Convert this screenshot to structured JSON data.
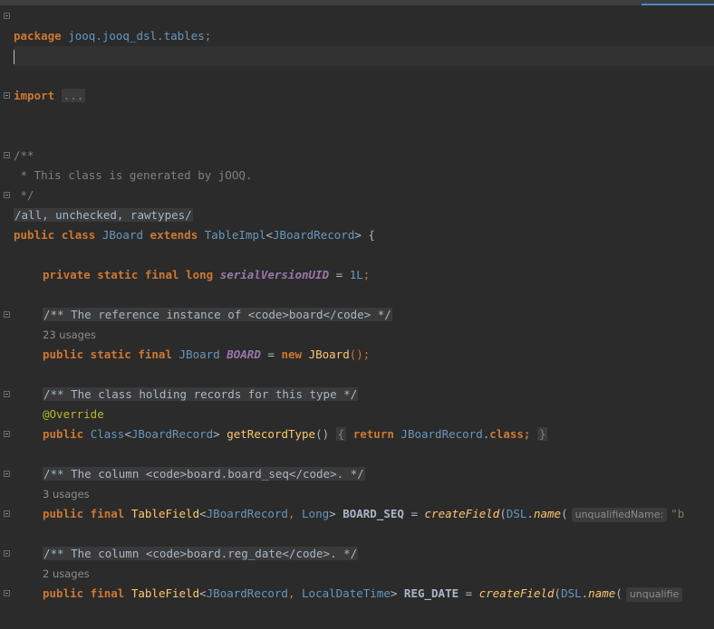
{
  "editor": {
    "folded_header": "/.../",
    "package_kw": "package",
    "package_name": "jooq.jooq_dsl.tables",
    "semicolon": ";",
    "import_kw": "import",
    "import_folded": "...",
    "doc_open": "/**",
    "doc_body": " * This class is generated by jOOQ.",
    "doc_close": " */",
    "suppress": "/all, unchecked, rawtypes/",
    "class_decl": {
      "public": "public",
      "class": "class",
      "name": "JBoard",
      "extends": "extends",
      "parent": "TableImpl",
      "lt": "<",
      "generic": "JBoardRecord",
      "gt": "> {"
    },
    "serial": {
      "mods": "private static final long",
      "name": "serialVersionUID",
      "eq": "=",
      "val": "1L",
      "semi": ";"
    },
    "c1": "/** The reference instance of <code>board</code> */",
    "u1": "23 usages",
    "board_field": {
      "mods": "public static final",
      "type": "JBoard",
      "name": "BOARD",
      "eq": "=",
      "new": "new",
      "ctor": "JBoard",
      "tail": "();"
    },
    "c2": "/** The class holding records for this type */",
    "override": "@Override",
    "getrt": {
      "public": "public",
      "type": "Class",
      "lt": "<",
      "gen": "JBoardRecord",
      "gt": ">",
      "name": "getRecordType",
      "paren": "()",
      "open": "{",
      "ret": "return",
      "cls": "JBoardRecord",
      "dot": ".",
      "classkw": "class;",
      "close": "}"
    },
    "c3": "/** The column <code>board.board_seq</code>. */",
    "u3": "3 usages",
    "seq": {
      "mods": "public final",
      "type": "TableField",
      "lt": "<",
      "g1": "JBoardRecord",
      "comma": ",",
      "g2": "Long",
      "gt": ">",
      "name": "BOARD_SEQ",
      "eq": "=",
      "fn": "createField",
      "paren": "(",
      "dsl": "DSL",
      "dot": ".",
      "nm": "name",
      "paren2": "(",
      "hint": "unqualifiedName:",
      "str": "\"b"
    },
    "c4": "/** The column <code>board.reg_date</code>. */",
    "u4": "2 usages",
    "reg": {
      "mods": "public final",
      "type": "TableField",
      "lt": "<",
      "g1": "JBoardRecord",
      "comma": ",",
      "g2": "LocalDateTime",
      "gt": ">",
      "name": "REG_DATE",
      "eq": "=",
      "fn": "createField",
      "paren": "(",
      "dsl": "DSL",
      "dot": ".",
      "nm": "name",
      "paren2": "(",
      "hint": "unqualifie"
    }
  },
  "colors": {
    "background": "#2b2b2b",
    "keyword": "#cc7832",
    "comment": "#808080",
    "accent": "#4a88c7"
  }
}
